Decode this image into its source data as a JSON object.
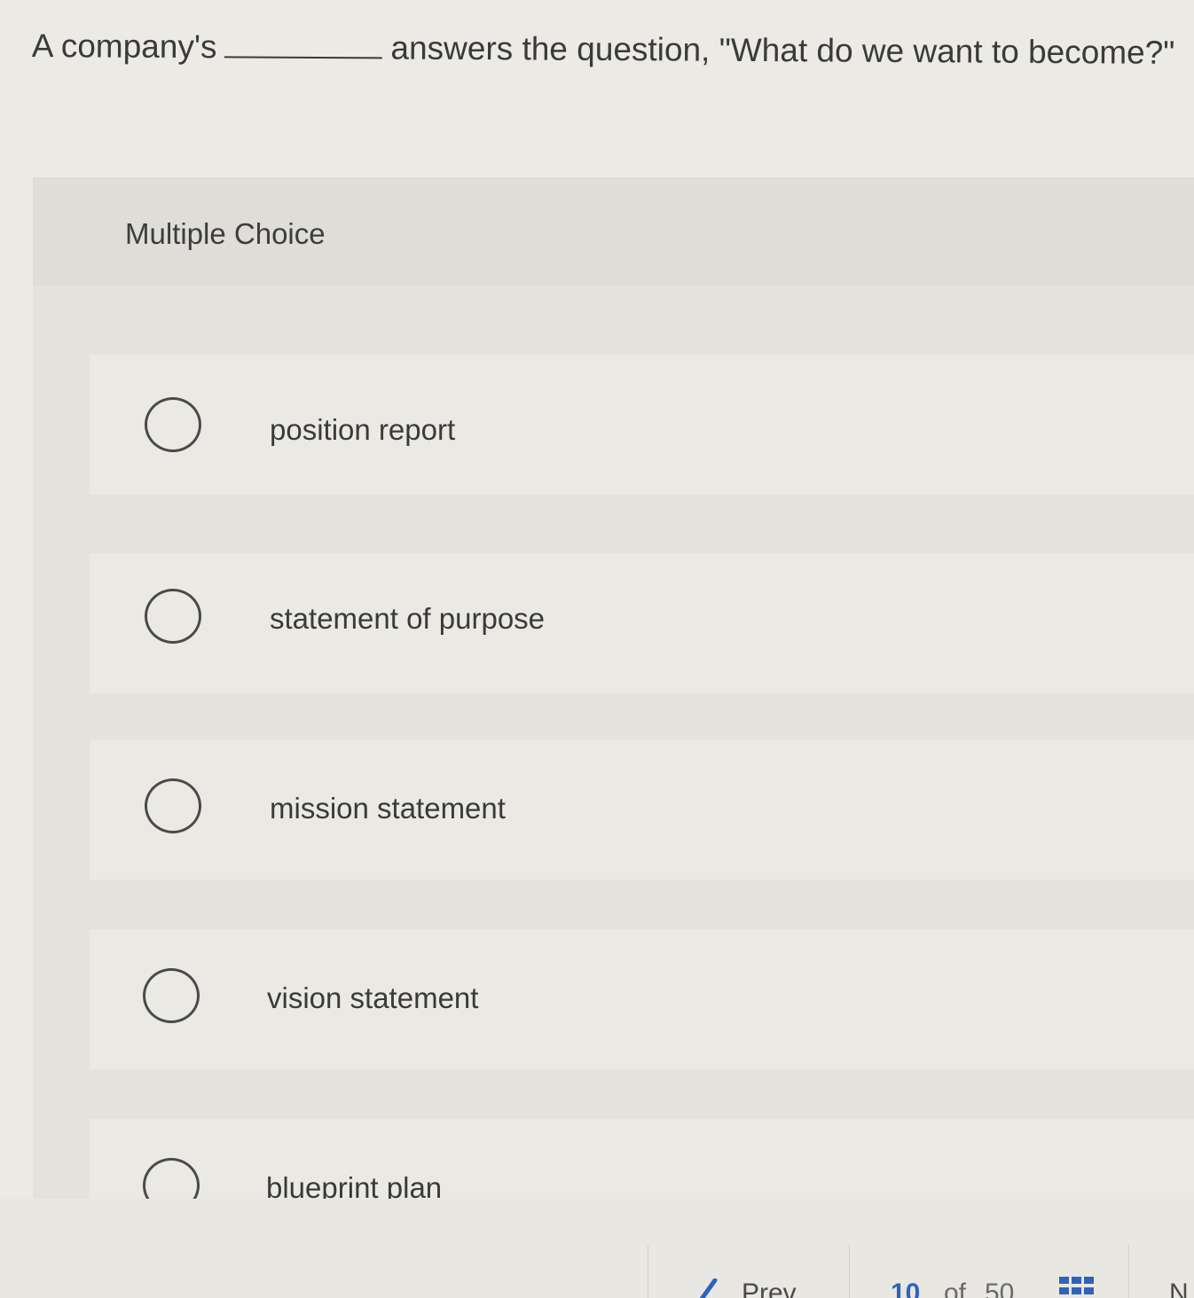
{
  "question": {
    "prefix": "A company's",
    "suffix": "answers the question, \"What do we want to become?\""
  },
  "multiple_choice": {
    "title": "Multiple Choice",
    "options": [
      {
        "label": "position report"
      },
      {
        "label": "statement of purpose"
      },
      {
        "label": "mission statement"
      },
      {
        "label": "vision statement"
      },
      {
        "label": "blueprint plan"
      }
    ]
  },
  "navigation": {
    "prev_label": "Prev",
    "current_page": "10",
    "of_label": "of",
    "total_pages": "50",
    "next_label": "N",
    "accent_color": "#2f63b8"
  }
}
